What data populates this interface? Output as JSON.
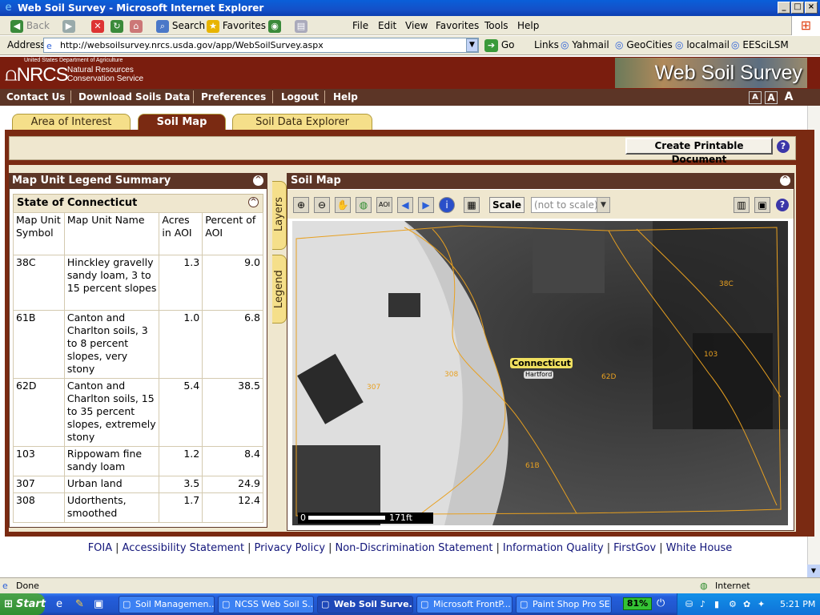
{
  "window": {
    "title": "Web Soil Survey - Microsoft Internet Explorer",
    "minimize": "_",
    "maximize": "□",
    "close": "×"
  },
  "toolbar": {
    "back": "Back",
    "search": "Search",
    "favorites": "Favorites"
  },
  "menu": [
    "File",
    "Edit",
    "View",
    "Favorites",
    "Tools",
    "Help"
  ],
  "address": {
    "label": "Address",
    "url": "http://websoilsurvey.nrcs.usda.gov/app/WebSoilSurvey.aspx",
    "go": "Go"
  },
  "links": {
    "label": "Links",
    "items": [
      "Yahmail",
      "GeoCities",
      "localmail",
      "EESciLSM"
    ]
  },
  "header": {
    "usda": "United States Department of Agriculture",
    "logo": "NRCS",
    "sub1": "Natural Resources",
    "sub2": "Conservation Service",
    "banner": "Web Soil Survey"
  },
  "nav": [
    "Contact Us",
    "Download Soils Data",
    "Preferences",
    "Logout",
    "Help"
  ],
  "font_sizes": [
    "A",
    "A",
    "A"
  ],
  "tabs": [
    {
      "label": "Area of Interest",
      "active": false
    },
    {
      "label": "Soil Map",
      "active": true
    },
    {
      "label": "Soil Data Explorer",
      "active": false
    }
  ],
  "print_button": "Create Printable Document",
  "help": "?",
  "collapse": "^",
  "legend": {
    "title": "Map Unit Legend Summary",
    "state": "State of Connecticut",
    "columns": [
      "Map Unit Symbol",
      "Map Unit Name",
      "Acres in AOI",
      "Percent of AOI"
    ],
    "rows": [
      {
        "symbol": "38C",
        "name": "Hinckley gravelly sandy loam, 3 to 15 percent slopes",
        "acres": "1.3",
        "percent": "9.0"
      },
      {
        "symbol": "61B",
        "name": "Canton and Charlton soils, 3 to 8 percent slopes, very stony",
        "acres": "1.0",
        "percent": "6.8"
      },
      {
        "symbol": "62D",
        "name": "Canton and Charlton soils, 15 to 35 percent slopes, extremely stony",
        "acres": "5.4",
        "percent": "38.5"
      },
      {
        "symbol": "103",
        "name": "Rippowam fine sandy loam",
        "acres": "1.2",
        "percent": "8.4"
      },
      {
        "symbol": "307",
        "name": "Urban land",
        "acres": "3.5",
        "percent": "24.9"
      },
      {
        "symbol": "308",
        "name": "Udorthents, smoothed",
        "acres": "1.7",
        "percent": "12.4"
      }
    ]
  },
  "side_tabs": [
    "Layers",
    "Legend"
  ],
  "map": {
    "title": "Soil Map",
    "scale_button": "Scale",
    "scale_select": "(not to scale)",
    "state_label": "Connecticut",
    "city_label": "Hartford",
    "unit_labels": [
      "38C",
      "103",
      "62D",
      "308",
      "307",
      "61B"
    ],
    "scalebar_start": "0",
    "scalebar_end": "171ft",
    "boundary_color": "#e8a020"
  },
  "footer": [
    "FOIA",
    "Accessibility Statement",
    "Privacy Policy",
    "Non-Discrimination Statement",
    "Information Quality",
    "FirstGov",
    "White House"
  ],
  "status": {
    "text": "Done",
    "zone": "Internet"
  },
  "taskbar": {
    "start": "Start",
    "tasks": [
      "Soil Managemen...",
      "NCSS Web Soil S...",
      "Web Soil Surve...",
      "Microsoft FrontP...",
      "Paint Shop Pro SE"
    ],
    "active_task": 2,
    "battery": "81%",
    "time": "5:21 PM"
  }
}
